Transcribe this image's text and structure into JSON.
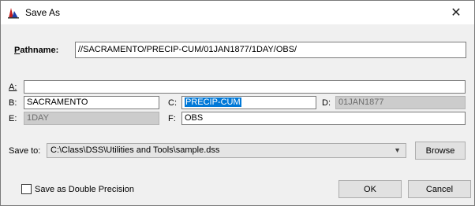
{
  "window": {
    "title": "Save As",
    "close_glyph": "✕"
  },
  "pathname": {
    "label": "Pathname:",
    "value": "//SACRAMENTO/PRECIP-CUM/01JAN1877/1DAY/OBS/"
  },
  "parts": {
    "a": {
      "label": "A:",
      "value": ""
    },
    "b": {
      "label": "B:",
      "value": "SACRAMENTO"
    },
    "c": {
      "label": "C:",
      "value": "PRECIP-CUM"
    },
    "d": {
      "label": "D:",
      "value": "01JAN1877"
    },
    "e": {
      "label": "E:",
      "value": "1DAY"
    },
    "f": {
      "label": "F:",
      "value": "OBS"
    }
  },
  "save_to": {
    "label": "Save to:",
    "value": "C:\\Class\\DSS\\Utilities and Tools\\sample.dss",
    "browse_label": "Browse"
  },
  "options": {
    "double_precision_label": "Save as Double Precision",
    "double_precision_checked": false
  },
  "buttons": {
    "ok": "OK",
    "cancel": "Cancel"
  },
  "icons": {
    "app": "hec-dssvue-icon",
    "close": "close-icon",
    "dropdown": "chevron-down-icon"
  }
}
